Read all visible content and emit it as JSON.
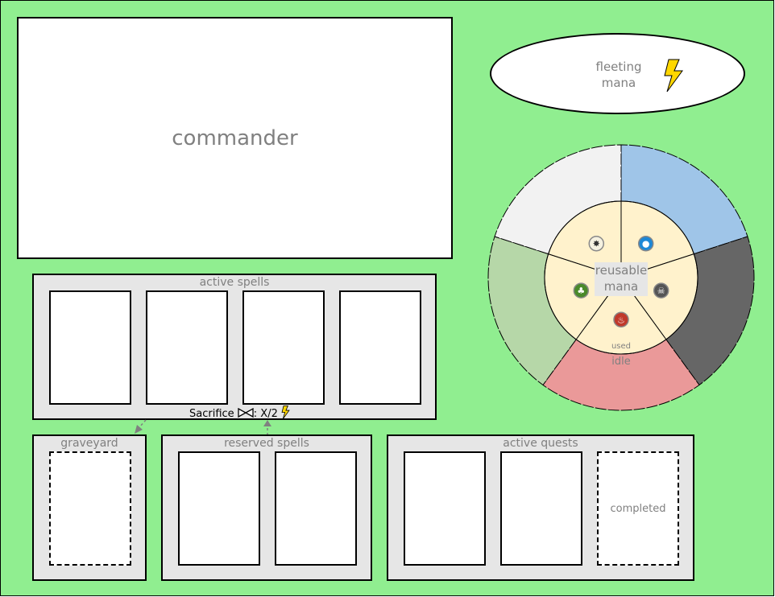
{
  "commander": {
    "label": "commander"
  },
  "fleeting_mana": {
    "label_line1": "fleeting",
    "label_line2": "mana",
    "icon": "lightning-bolt"
  },
  "reusable_mana": {
    "label_line1": "reusable",
    "label_line2": "mana",
    "used_label": "used",
    "idle_label": "idle",
    "segments": [
      {
        "name": "white",
        "color": "#f2f2f2",
        "icon": "white-sun-mana-icon"
      },
      {
        "name": "blue",
        "color": "#9fc5e8",
        "icon": "blue-water-mana-icon"
      },
      {
        "name": "black",
        "color": "#666666",
        "icon": "black-skull-mana-icon"
      },
      {
        "name": "red",
        "color": "#ea9999",
        "icon": "red-fire-mana-icon"
      },
      {
        "name": "green",
        "color": "#b6d7a8",
        "icon": "green-tree-mana-icon"
      }
    ],
    "inner_color": "#fff2cc"
  },
  "active_spells": {
    "title": "active spells",
    "slots": 4
  },
  "sacrifice": {
    "prefix": "Sacrifice",
    "suffix": ": X/2"
  },
  "graveyard": {
    "title": "graveyard"
  },
  "reserved_spells": {
    "title": "reserved spells",
    "slots": 2
  },
  "active_quests": {
    "title": "active quests",
    "slots": 2,
    "completed_label": "completed"
  },
  "colors": {
    "board": "#90ee90",
    "panel": "#e6e6e6",
    "muted_text": "#808080",
    "bolt": "#ffd700"
  }
}
